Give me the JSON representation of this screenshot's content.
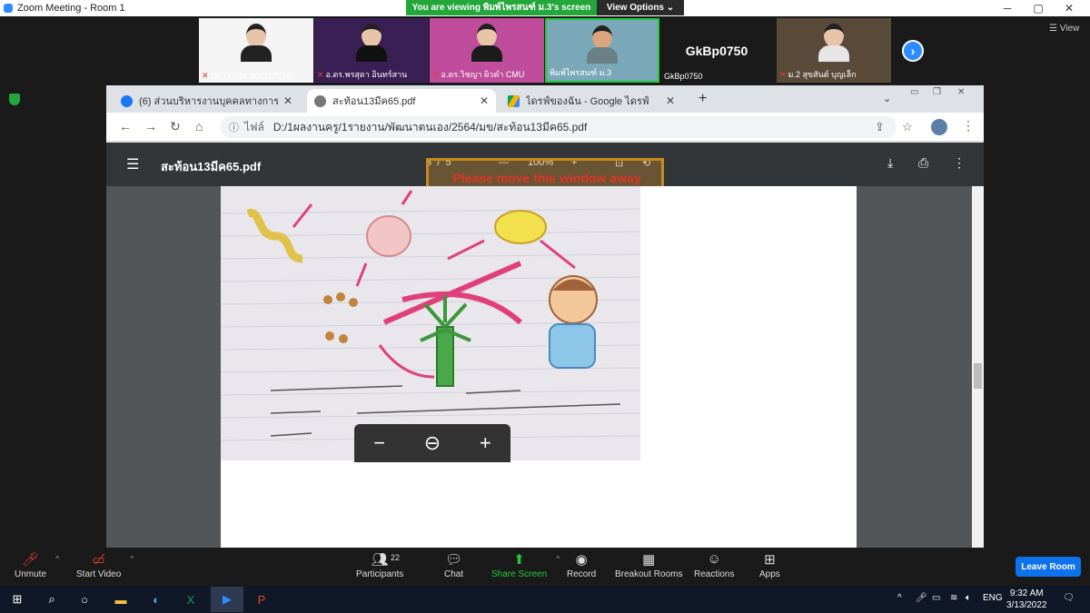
{
  "zoom": {
    "window_title": "Zoom Meeting - Room 1",
    "viewing_banner": "You are viewing พิมพ์ไพรสนฑ์ ม.3's screen",
    "view_options": "View Options ⌄",
    "view_label": "View"
  },
  "participants": [
    {
      "name": "METICHA BOOTPENG"
    },
    {
      "name": "อ.ดร.พรสุดา อินทร์สาน"
    },
    {
      "name": "อ.ดร.วิชญา ผิวคำ CMU"
    },
    {
      "name": "พิมพ์ไพรสนฑ์ ม.3"
    },
    {
      "name": "GkBp0750",
      "big_label": "GkBp0750"
    },
    {
      "name": "ม.2 สุขสันต์ บุญเล็ก"
    }
  ],
  "browser": {
    "tabs": [
      {
        "label": "(6) ส่วนบริหารงานบุคคลทางการศึกษา",
        "active": false
      },
      {
        "label": "สะท้อน13มีค65.pdf",
        "active": true
      },
      {
        "label": "ไดรฟ์ของฉัน - Google ไดรฟ์",
        "active": false
      }
    ],
    "address_scheme": "ไฟล์",
    "address": "D:/1ผลงานครู/1รายงาน/พัฒนาตนเอง/2564/มข/สะท้อน13มีค65.pdf"
  },
  "pdf": {
    "title": "สะท้อน13มีค65.pdf",
    "page": "3",
    "separator": "/",
    "total_pages": "5",
    "zoom_minus": "—",
    "zoom": "100%",
    "zoom_plus": "+",
    "overlay_warning": "Please move this window away"
  },
  "controls": {
    "unmute": "Unmute",
    "start_video": "Start Video",
    "participants": "Participants",
    "participants_count": "22",
    "chat": "Chat",
    "share_screen": "Share Screen",
    "record": "Record",
    "breakout_rooms": "Breakout Rooms",
    "reactions": "Reactions",
    "apps": "Apps",
    "leave_room": "Leave Room"
  },
  "taskbar": {
    "language": "ENG",
    "time": "9:32 AM",
    "date": "3/13/2022"
  }
}
